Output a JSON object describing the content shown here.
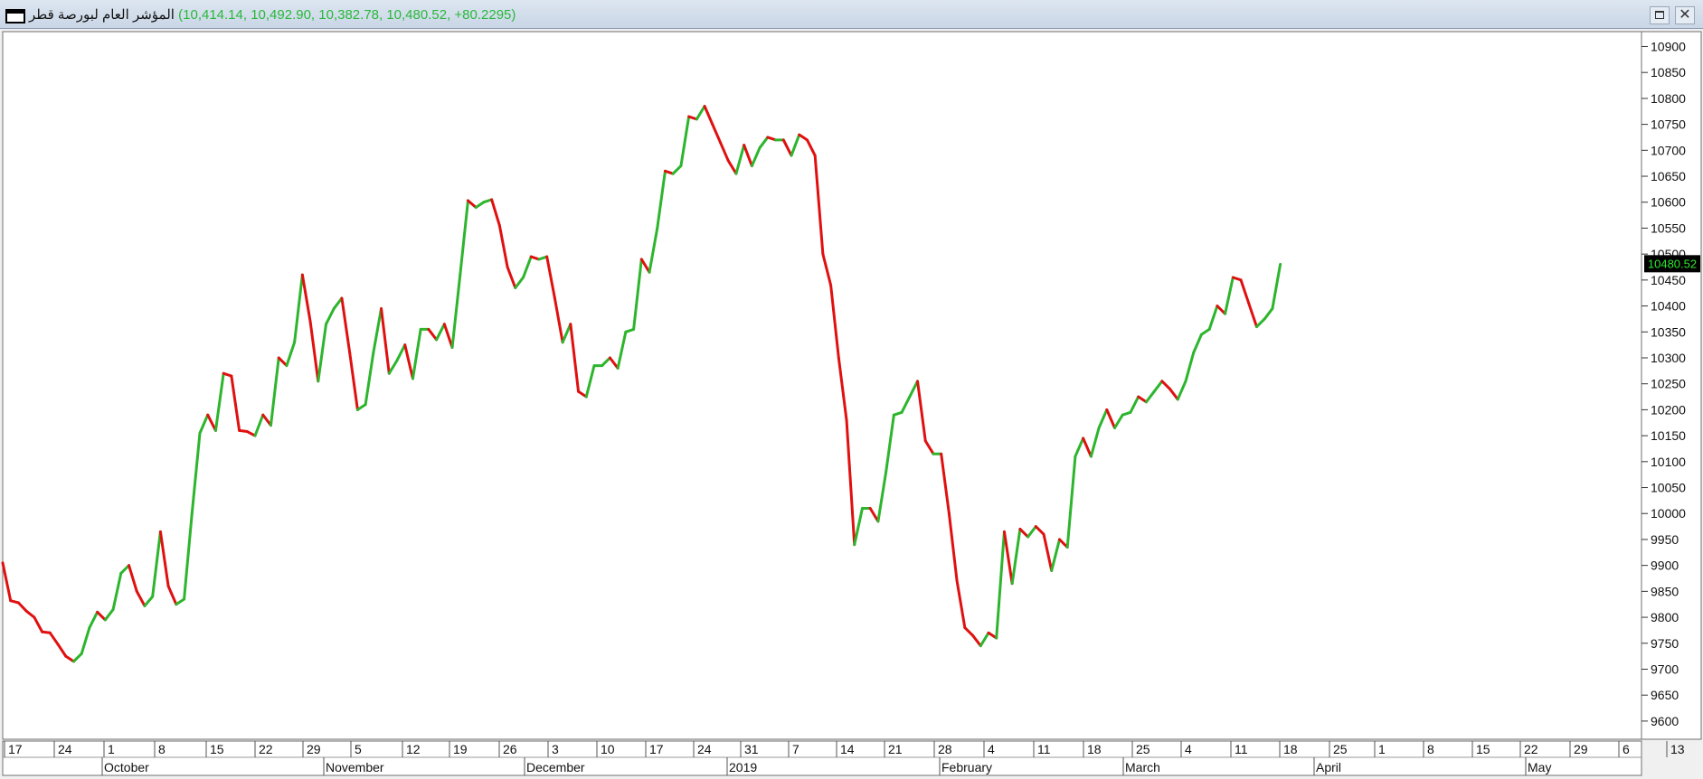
{
  "window": {
    "title": "المؤشر العام لبورصة قطر",
    "values": "(10,414.14, 10,492.90, 10,382.78, 10,480.52, +80.2295)",
    "maximize_label": "",
    "close_label": "✕"
  },
  "colors": {
    "up": "#2db52d",
    "down": "#e01010",
    "last_price_bg": "#000000",
    "last_price_text": "#2ee82e"
  },
  "chart_data": {
    "type": "line",
    "title": "",
    "xlabel": "",
    "ylabel": "",
    "ylim": [
      9565,
      10920
    ],
    "yticks": [
      9600,
      9650,
      9700,
      9750,
      9800,
      9850,
      9900,
      9950,
      10000,
      10050,
      10100,
      10150,
      10200,
      10250,
      10300,
      10350,
      10400,
      10450,
      10500,
      10550,
      10600,
      10650,
      10700,
      10750,
      10800,
      10850,
      10900
    ],
    "last_price_label": "10480.52",
    "day_labels": [
      "17",
      "24",
      "1",
      "8",
      "15",
      "22",
      "29",
      "5",
      "12",
      "19",
      "26",
      "3",
      "10",
      "17",
      "24",
      "31",
      "7",
      "14",
      "21",
      "28",
      "4",
      "11",
      "18",
      "25",
      "4",
      "11",
      "18",
      "25",
      "1",
      "8",
      "15",
      "22",
      "29",
      "6",
      "13"
    ],
    "month_labels": [
      "October",
      "November",
      "December",
      "2019",
      "February",
      "March",
      "April",
      "May"
    ],
    "grid": false,
    "series": [
      {
        "values": [
          9905,
          9832,
          9828,
          9812,
          9800,
          9772,
          9770,
          9748,
          9725,
          9715,
          9730,
          9780,
          9810,
          9795,
          9815,
          9885,
          9900,
          9850,
          9822,
          9840,
          9965,
          9860,
          9825,
          9835,
          10000,
          10155,
          10190,
          10160,
          10270,
          10265,
          10160,
          10158,
          10150,
          10190,
          10170,
          10300,
          10285,
          10330,
          10460,
          10370,
          10255,
          10365,
          10395,
          10415,
          10310,
          10200,
          10210,
          10310,
          10395,
          10270,
          10295,
          10325,
          10260,
          10355,
          10355,
          10335,
          10365,
          10320,
          10460,
          10603,
          10590,
          10600,
          10605,
          10555,
          10475,
          10435,
          10455,
          10495,
          10490,
          10495,
          10415,
          10330,
          10365,
          10235,
          10225,
          10285,
          10285,
          10300,
          10280,
          10350,
          10355,
          10490,
          10465,
          10550,
          10660,
          10655,
          10670,
          10765,
          10760,
          10785,
          10750,
          10715,
          10680,
          10655,
          10710,
          10670,
          10705,
          10725,
          10720,
          10720,
          10690,
          10730,
          10720,
          10690,
          10500,
          10440,
          10300,
          10180,
          9940,
          10010,
          10010,
          9985,
          10080,
          10190,
          10195,
          10225,
          10255,
          10140,
          10115,
          10115,
          10000,
          9870,
          9780,
          9765,
          9745,
          9770,
          9760,
          9965,
          9865,
          9970,
          9955,
          9975,
          9960,
          9890,
          9950,
          9935,
          10110,
          10145,
          10110,
          10165,
          10200,
          10165,
          10190,
          10195,
          10225,
          10215,
          10235,
          10255,
          10240,
          10220,
          10255,
          10310,
          10345,
          10355,
          10400,
          10385,
          10455,
          10450,
          10405,
          10360,
          10375,
          10395,
          10480.52
        ]
      }
    ]
  }
}
